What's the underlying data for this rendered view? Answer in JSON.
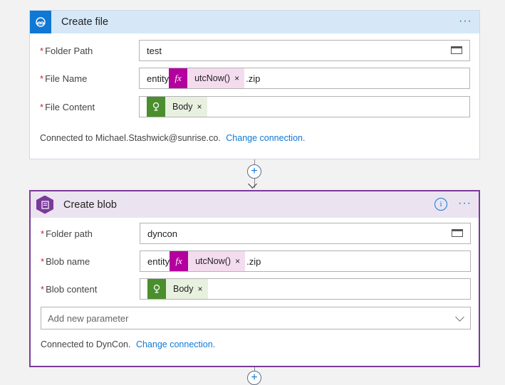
{
  "create_file": {
    "title": "Create file",
    "more": "···",
    "folder_path": {
      "label": "Folder Path",
      "value": "test"
    },
    "file_name": {
      "label": "File Name",
      "prefix": "entity",
      "token": "utcNow()",
      "suffix": ".zip"
    },
    "file_content": {
      "label": "File Content",
      "token": "Body"
    },
    "connected_text": "Connected to Michael.Stashwick@sunrise.co.",
    "change_connection": "Change connection."
  },
  "create_blob": {
    "title": "Create blob",
    "info": "i",
    "more": "···",
    "folder_path": {
      "label": "Folder path",
      "value": "dyncon"
    },
    "blob_name": {
      "label": "Blob name",
      "prefix": "entity",
      "token": "utcNow()",
      "suffix": ".zip"
    },
    "blob_content": {
      "label": "Blob content",
      "token": "Body"
    },
    "add_parameter_placeholder": "Add new parameter",
    "connected_text": "Connected to DynCon.",
    "change_connection": "Change connection."
  },
  "common": {
    "required_mark": "*",
    "remove": "×",
    "fx": "fx",
    "plus": "+"
  },
  "colors": {
    "accent": "#0f78d4",
    "blob_purple": "#7a3a9a",
    "fx_magenta": "#b4009e",
    "body_green": "#4a8e2d"
  }
}
